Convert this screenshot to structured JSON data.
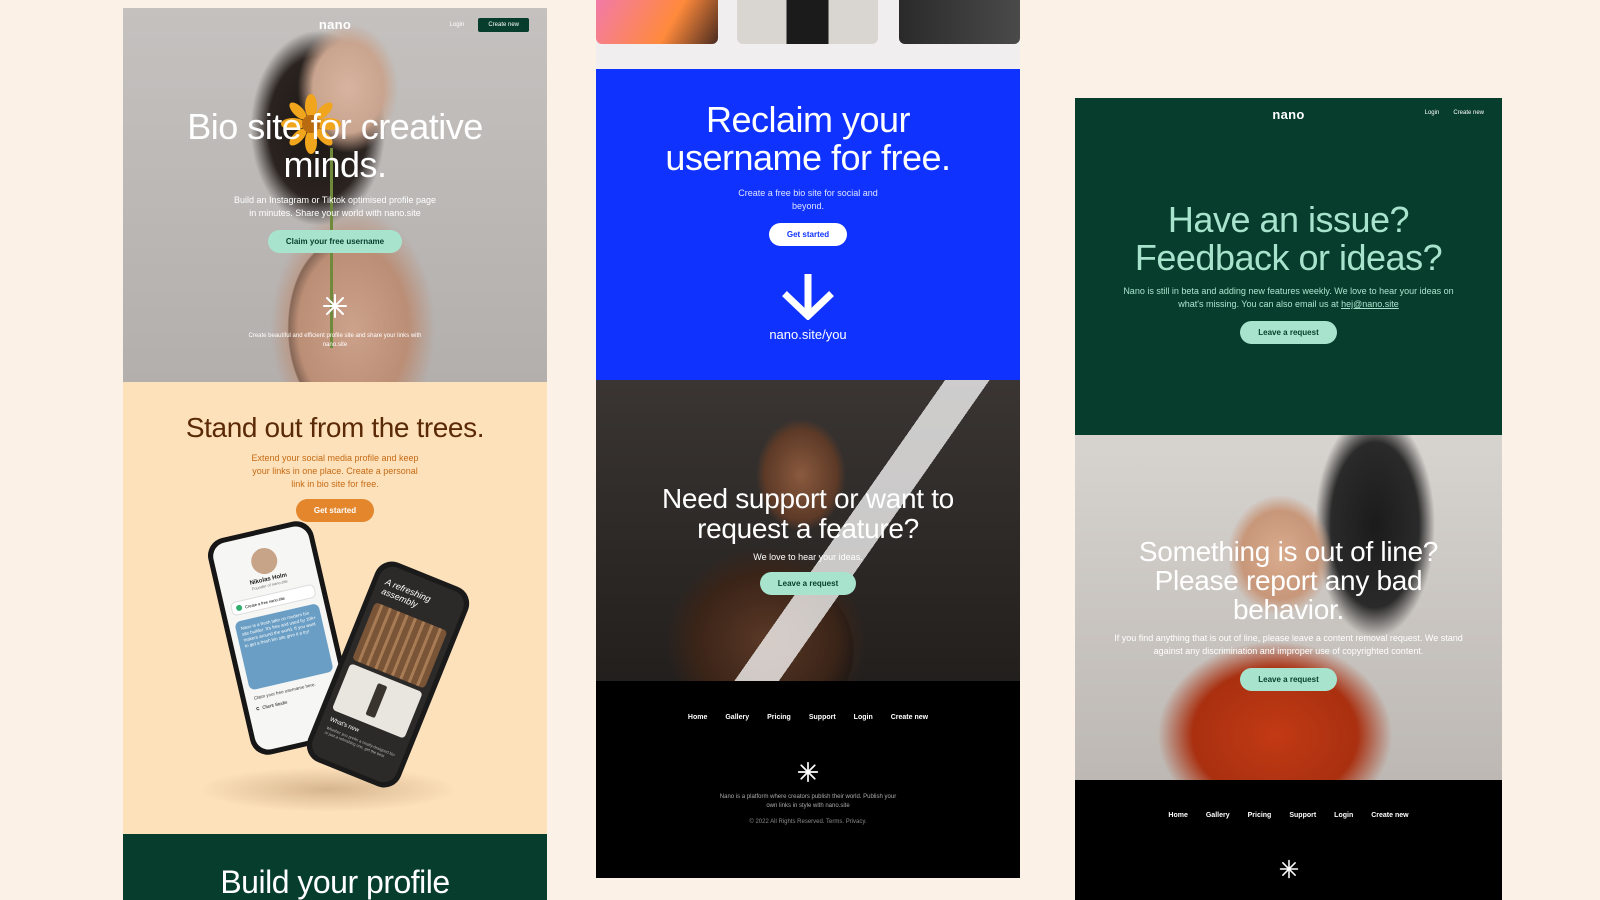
{
  "colors": {
    "page_bg": "#fbf1e7",
    "mint": "#a8e4cd",
    "dark_green": "#073d2d",
    "brand_blue": "#0f32ff",
    "peach": "#fde1bb",
    "orange": "#e3862c",
    "brown_text": "#5a2a06"
  },
  "col1": {
    "nav": {
      "logo": "nano",
      "login": "Login",
      "create_new": "Create new"
    },
    "hero": {
      "title": "Bio site for creative minds.",
      "subtitle": "Build an Instagram or Tiktok optimised profile page in minutes. Share your world with nano.site",
      "cta": "Claim your free username",
      "caption": "Create beautiful and efficient profile site and share your links with nano.site"
    },
    "trees": {
      "title": "Stand out from the trees.",
      "subtitle": "Extend your social media profile and keep your links in one place. Create a personal link in bio site for free.",
      "cta": "Get started"
    },
    "phone_left": {
      "name": "Nikolas Holm",
      "role": "Founder of nano.site",
      "pill": "Create a free nano.site",
      "card_text": "Nano is a fresh take on modern bio site builder. It's free and used by 10k+ makers around the world. If you want to get a fresh bio site give it a try!",
      "claim": "Claim your free username here.",
      "client": "Client Studio"
    },
    "phone_right": {
      "headline": "A refreshing assembly",
      "whats_new": "What's new",
      "whats_new_sub": "Whether you prefer a neatly-designed bio or just a refreshing one, get the best"
    },
    "bottom": {
      "title": "Build your profile"
    }
  },
  "col2": {
    "claim": {
      "title": "Reclaim your username for free.",
      "subtitle": "Create a free bio site for social and beyond.",
      "cta": "Get started",
      "url": "nano.site/you"
    },
    "support": {
      "title": "Need support or want to request a feature?",
      "subtitle": "We love to hear your ideas.",
      "cta": "Leave a request"
    },
    "footer": {
      "links": [
        "Home",
        "Gallery",
        "Pricing",
        "Support",
        "Login",
        "Create new"
      ],
      "about": "Nano is a platform where creators publish their world. Publish your own links in style with nano.site",
      "legal": "© 2022 All Rights Reserved. Terms. Privacy."
    }
  },
  "col3": {
    "nav": {
      "logo": "nano",
      "login": "Login",
      "create_new": "Create new"
    },
    "feedback": {
      "title": "Have an issue? Feedback or ideas?",
      "body": "Nano is still in beta and adding new features weekly. We love to hear your ideas on what's missing. You can also email us at",
      "email": "hej@nano.site",
      "cta": "Leave a request"
    },
    "report": {
      "title": "Something is out of line? Please report any bad behavior.",
      "body": "If you find anything that is out of line, please leave a content removal request. We stand against any discrimination and improper use of copyrighted content.",
      "cta": "Leave a request"
    },
    "footer": {
      "links": [
        "Home",
        "Gallery",
        "Pricing",
        "Support",
        "Login",
        "Create new"
      ]
    }
  }
}
